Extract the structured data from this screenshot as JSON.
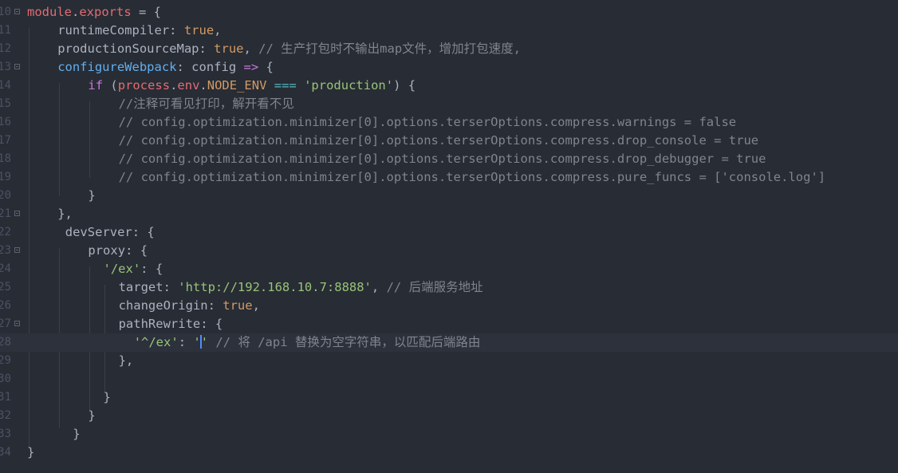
{
  "editor": {
    "lines": [
      {
        "num": "10",
        "fold": true,
        "indent": 0,
        "tokens": [
          [
            "mod",
            "module"
          ],
          [
            "pun",
            "."
          ],
          [
            "mod",
            "exports"
          ],
          [
            "pun",
            " = {"
          ]
        ]
      },
      {
        "num": "11",
        "fold": false,
        "indent": 4,
        "tokens": [
          [
            "key",
            "runtimeCompiler"
          ],
          [
            "pun",
            ": "
          ],
          [
            "bool",
            "true"
          ],
          [
            "pun",
            ","
          ]
        ]
      },
      {
        "num": "12",
        "fold": false,
        "indent": 4,
        "tokens": [
          [
            "key",
            "productionSourceMap"
          ],
          [
            "pun",
            ": "
          ],
          [
            "bool",
            "true"
          ],
          [
            "pun",
            ", "
          ],
          [
            "cm",
            "// 生产打包时不输出map文件，增加打包速度,"
          ]
        ]
      },
      {
        "num": "13",
        "fold": true,
        "indent": 4,
        "tokens": [
          [
            "fn",
            "configureWebpack"
          ],
          [
            "pun",
            ": config "
          ],
          [
            "kw",
            "=>"
          ],
          [
            "pun",
            " {"
          ]
        ]
      },
      {
        "num": "14",
        "fold": false,
        "indent": 8,
        "tokens": [
          [
            "kw",
            "if"
          ],
          [
            "pun",
            " ("
          ],
          [
            "var",
            "process"
          ],
          [
            "pun",
            "."
          ],
          [
            "var",
            "env"
          ],
          [
            "pun",
            "."
          ],
          [
            "const",
            "NODE_ENV"
          ],
          [
            "pun",
            " "
          ],
          [
            "op",
            "==="
          ],
          [
            "pun",
            " "
          ],
          [
            "str",
            "'production'"
          ],
          [
            "pun",
            ") {"
          ]
        ]
      },
      {
        "num": "15",
        "fold": false,
        "indent": 12,
        "tokens": [
          [
            "cm",
            "//注释可看见打印，解开看不见"
          ]
        ]
      },
      {
        "num": "16",
        "fold": false,
        "indent": 12,
        "tokens": [
          [
            "cm",
            "// config.optimization.minimizer[0].options.terserOptions.compress.warnings = false"
          ]
        ]
      },
      {
        "num": "17",
        "fold": false,
        "indent": 12,
        "tokens": [
          [
            "cm",
            "// config.optimization.minimizer[0].options.terserOptions.compress.drop_console = true"
          ]
        ]
      },
      {
        "num": "18",
        "fold": false,
        "indent": 12,
        "tokens": [
          [
            "cm",
            "// config.optimization.minimizer[0].options.terserOptions.compress.drop_debugger = true"
          ]
        ]
      },
      {
        "num": "19",
        "fold": false,
        "indent": 12,
        "tokens": [
          [
            "cm",
            "// config.optimization.minimizer[0].options.terserOptions.compress.pure_funcs = ['console.log']"
          ]
        ]
      },
      {
        "num": "20",
        "fold": false,
        "indent": 8,
        "tokens": [
          [
            "pun",
            "}"
          ]
        ]
      },
      {
        "num": "21",
        "fold": true,
        "indent": 4,
        "tokens": [
          [
            "pun",
            "},"
          ]
        ]
      },
      {
        "num": "22",
        "fold": false,
        "indent": 5,
        "tokens": [
          [
            "key",
            "devServer"
          ],
          [
            "pun",
            ": {"
          ]
        ]
      },
      {
        "num": "23",
        "fold": true,
        "indent": 8,
        "tokens": [
          [
            "key",
            "proxy"
          ],
          [
            "pun",
            ": {"
          ]
        ]
      },
      {
        "num": "24",
        "fold": false,
        "indent": 10,
        "tokens": [
          [
            "str",
            "'/ex'"
          ],
          [
            "pun",
            ": {"
          ]
        ]
      },
      {
        "num": "25",
        "fold": false,
        "indent": 12,
        "tokens": [
          [
            "key",
            "target"
          ],
          [
            "pun",
            ": "
          ],
          [
            "str",
            "'http://192.168.10.7:8888'"
          ],
          [
            "pun",
            ", "
          ],
          [
            "cm",
            "// 后端服务地址"
          ]
        ]
      },
      {
        "num": "26",
        "fold": false,
        "indent": 12,
        "tokens": [
          [
            "key",
            "changeOrigin"
          ],
          [
            "pun",
            ": "
          ],
          [
            "bool",
            "true"
          ],
          [
            "pun",
            ","
          ]
        ]
      },
      {
        "num": "27",
        "fold": true,
        "indent": 12,
        "tokens": [
          [
            "key",
            "pathRewrite"
          ],
          [
            "pun",
            ": {"
          ]
        ]
      },
      {
        "num": "28",
        "fold": false,
        "indent": 14,
        "active": true,
        "tokens": [
          [
            "str",
            "'^/ex'"
          ],
          [
            "pun",
            ": "
          ],
          [
            "str",
            "'"
          ],
          [
            "cursor",
            ""
          ],
          [
            "str",
            "'"
          ],
          [
            "pun",
            " "
          ],
          [
            "cm",
            "// 将 /api 替换为空字符串，以匹配后端路由"
          ]
        ]
      },
      {
        "num": "29",
        "fold": false,
        "indent": 12,
        "tokens": [
          [
            "pun",
            "},"
          ]
        ]
      },
      {
        "num": "30",
        "fold": false,
        "indent": 0,
        "tokens": []
      },
      {
        "num": "31",
        "fold": false,
        "indent": 10,
        "tokens": [
          [
            "pun",
            "}"
          ]
        ]
      },
      {
        "num": "32",
        "fold": false,
        "indent": 8,
        "tokens": [
          [
            "pun",
            "}"
          ]
        ]
      },
      {
        "num": "33",
        "fold": false,
        "indent": 6,
        "tokens": [
          [
            "pun",
            "}"
          ]
        ]
      },
      {
        "num": "34",
        "fold": false,
        "indent": 0,
        "tokens": [
          [
            "pun",
            "}"
          ]
        ]
      }
    ]
  }
}
